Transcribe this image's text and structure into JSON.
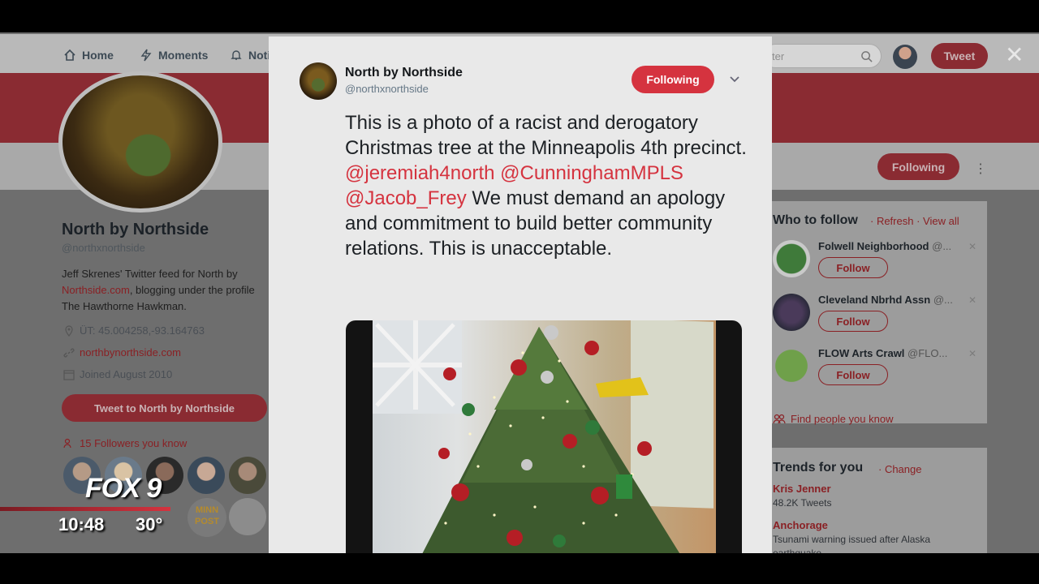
{
  "nav": {
    "home": "Home",
    "moments": "Moments",
    "notifications": "Noti",
    "search_placeholder": "ter",
    "tweet_button": "Tweet"
  },
  "profile": {
    "name": "North by Northside",
    "handle": "@northxnorthside",
    "bio_pre": "Jeff Skrenes' Twitter feed for North by ",
    "bio_link": "Northside.com",
    "bio_post": ", blogging under the profile The Hawthorne Hawkman.",
    "location": "ÜT: 45.004258,-93.164763",
    "website": "northbynorthside.com",
    "joined": "Joined August 2010",
    "tweet_to_button": "Tweet to North by Northside",
    "followers_you_know": "15 Followers you know",
    "following_button": "Following",
    "minnpost": "MINN POST"
  },
  "who_to_follow": {
    "title": "Who to follow",
    "refresh": "· Refresh",
    "view_all": "· View all",
    "follow_label": "Follow",
    "suggestions": [
      {
        "name": "Folwell Neighborhood",
        "handle": "@..."
      },
      {
        "name": "Cleveland Nbrhd Assn",
        "handle": "@..."
      },
      {
        "name": "FLOW Arts Crawl",
        "handle": "@FLO..."
      }
    ],
    "find_people": "Find people you know"
  },
  "trends": {
    "title": "Trends for you",
    "change": "· Change",
    "items": [
      {
        "name": "Kris Jenner",
        "sub": "48.2K Tweets"
      },
      {
        "name": "Anchorage",
        "sub": "Tsunami warning issued after Alaska earthquake"
      }
    ]
  },
  "modal": {
    "name": "North by Northside",
    "handle": "@northxnorthside",
    "following_button": "Following",
    "text_1": "This is a photo of a racist and derogatory Christmas tree at the Minneapolis 4th precinct. ",
    "mention_1": "@jeremiah4north",
    "mention_2": "@CunninghamMPLS",
    "mention_3": "@Jacob_Frey",
    "text_2": " We must demand an apology and commitment to build better community relations. This is unacceptable."
  },
  "overlay": {
    "channel": "FOX 9",
    "time": "10:48",
    "temp": "30°"
  },
  "colors": {
    "accent": "#d5333f",
    "accent_dim": "#8a2b32"
  }
}
